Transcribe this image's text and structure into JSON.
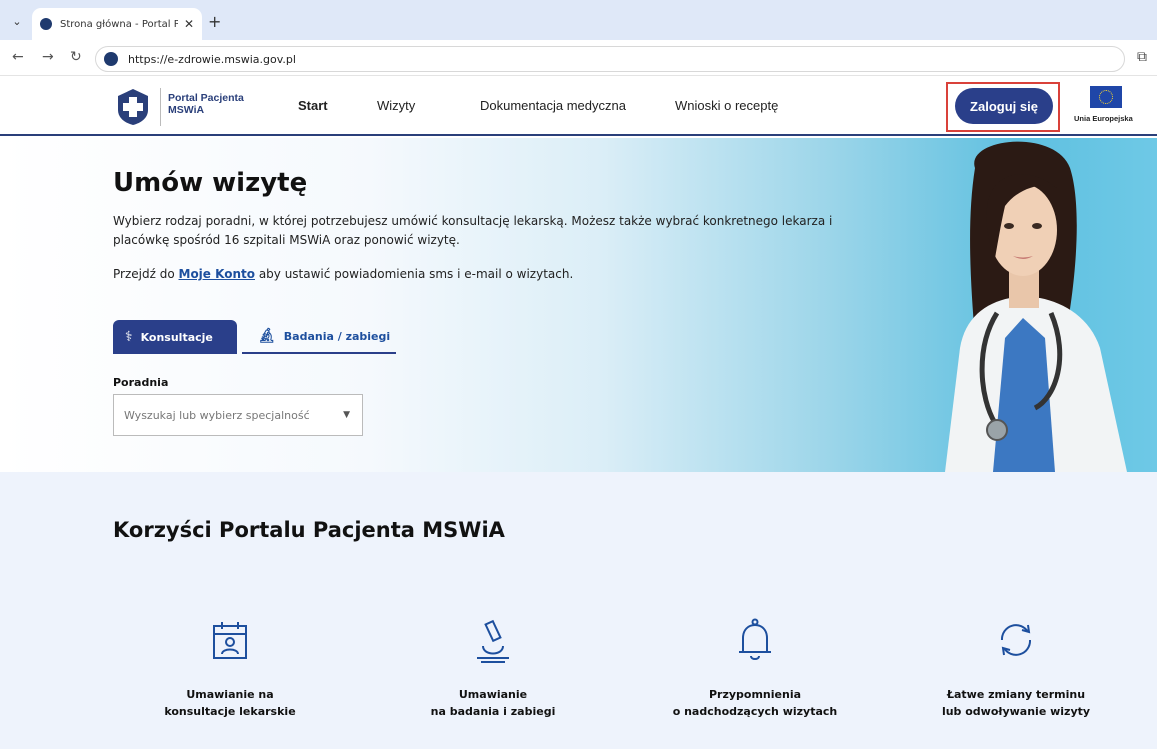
{
  "browser": {
    "tab_title": "Strona główna - Portal Pacjenta M",
    "url": "https://e-zdrowie.mswia.gov.pl"
  },
  "header": {
    "logo_line1": "Portal Pacjenta",
    "logo_line2": "MSWiA",
    "nav": [
      "Start",
      "Wizyty",
      "Dokumentacja medyczna",
      "Wnioski o receptę"
    ],
    "login_label": "Zaloguj się",
    "eu_label": "Unia Europejska"
  },
  "hero": {
    "title": "Umów wizytę",
    "description": "Wybierz rodzaj poradni, w której potrzebujesz umówić konsultację lekarską. Możesz także wybrać konkretnego lekarza i placówkę spośród 16 szpitali MSWiA oraz ponowić wizytę.",
    "account_prefix": "Przejdź do",
    "account_link": "Moje Konto",
    "account_suffix": "aby ustawić powiadomienia sms i e-mail o wizytach.",
    "tab1": "Konsultacje",
    "tab2": "Badania / zabiegi",
    "field_label": "Poradnia",
    "select_placeholder": "Wyszukaj lub wybierz specjalność"
  },
  "benefits": {
    "title": "Korzyści Portalu Pacjenta MSWiA",
    "items": [
      {
        "line1": "Umawianie na",
        "line2": "konsultacje lekarskie",
        "icon": "calendar-doctor-icon"
      },
      {
        "line1": "Umawianie",
        "line2": "na badania i zabiegi",
        "icon": "microscope-icon"
      },
      {
        "line1": "Przypomnienia",
        "line2": "o nadchodzących wizytach",
        "icon": "bell-icon"
      },
      {
        "line1": "Łatwe zmiany terminu",
        "line2": "lub odwoływanie wizyty",
        "icon": "refresh-icon"
      }
    ]
  }
}
